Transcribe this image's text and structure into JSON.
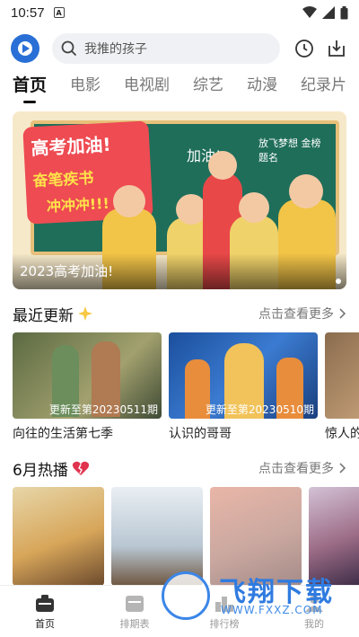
{
  "status_bar": {
    "time": "10:57",
    "notification_glyph": "A"
  },
  "header": {
    "search_placeholder": "我推的孩子"
  },
  "tabs": [
    {
      "label": "首页",
      "active": true
    },
    {
      "label": "电影",
      "active": false
    },
    {
      "label": "电视剧",
      "active": false
    },
    {
      "label": "综艺",
      "active": false
    },
    {
      "label": "动漫",
      "active": false
    },
    {
      "label": "纪录片",
      "active": false
    }
  ],
  "banner": {
    "caption": "2023高考加油!",
    "sign_line1": "高考加油!",
    "sign_line2": "奋笔疾书",
    "sign_line3": "冲冲冲!!!",
    "chalk_left": "加油!",
    "chalk_right": "放飞梦想 金榜题名"
  },
  "recent": {
    "title": "最近更新",
    "more": "点击查看更多",
    "items": [
      {
        "title": "向往的生活第七季",
        "badge": "更新至第20230511期"
      },
      {
        "title": "认识的哥哥",
        "badge": "更新至第20230510期"
      },
      {
        "title": "惊人的"
      }
    ]
  },
  "hot": {
    "title": "6月热播",
    "more": "点击查看更多"
  },
  "bottom_nav": [
    {
      "label": "首页",
      "icon": "home-icon",
      "active": true
    },
    {
      "label": "排期表",
      "icon": "calendar-icon",
      "active": false
    },
    {
      "label": "排行榜",
      "icon": "rank-icon",
      "active": false
    },
    {
      "label": "我的",
      "icon": "user-icon",
      "active": false
    }
  ],
  "watermark": {
    "big": "飞翔下载",
    "small": "WWW.FXXZ.COM"
  },
  "colors": {
    "accent": "#2a6fd6",
    "search_bg": "#f0f1f4"
  }
}
